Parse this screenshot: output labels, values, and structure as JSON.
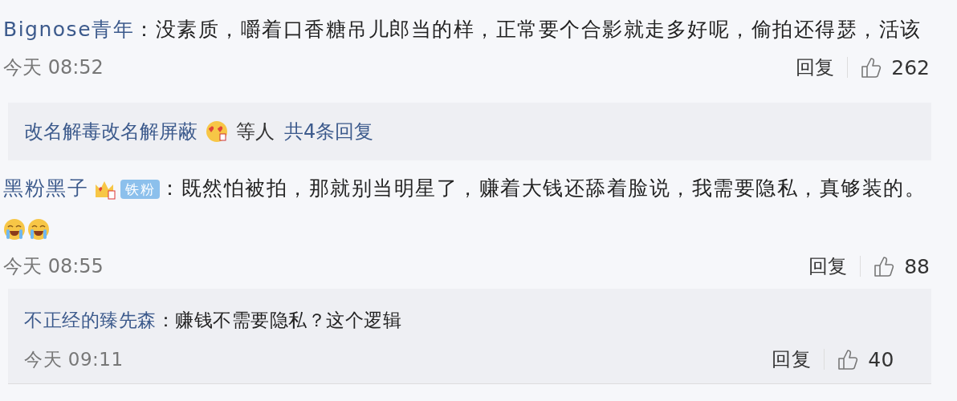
{
  "comments": [
    {
      "author": "Bignose青年",
      "text": "：没素质，嚼着口香糖吊儿郎当的样，正常要个合影就走多好呢，偷拍还得瑟，活该",
      "time": "今天 08:52",
      "reply_label": "回复",
      "likes": "262",
      "reply_summary": {
        "names": "改名解毒改名解屏蔽",
        "suffix": "等人",
        "count": "共4条回复"
      }
    },
    {
      "author": "黑粉黑子",
      "crown": true,
      "fan_badge": "铁粉",
      "text": "：既然怕被拍，那就别当明星了，赚着大钱还舔着脸说，我需要隐私，真够装的。",
      "emojis": [
        {
          "kind": "laughing-crying"
        },
        {
          "kind": "laughing-crying"
        }
      ],
      "time": "今天 08:55",
      "reply_label": "回复",
      "likes": "88",
      "replies": [
        {
          "author": "不正经的臻先森",
          "text": "：赚钱不需要隐私？这个逻辑",
          "time": "今天 09:11",
          "reply_label": "回复",
          "likes": "40"
        }
      ]
    }
  ]
}
